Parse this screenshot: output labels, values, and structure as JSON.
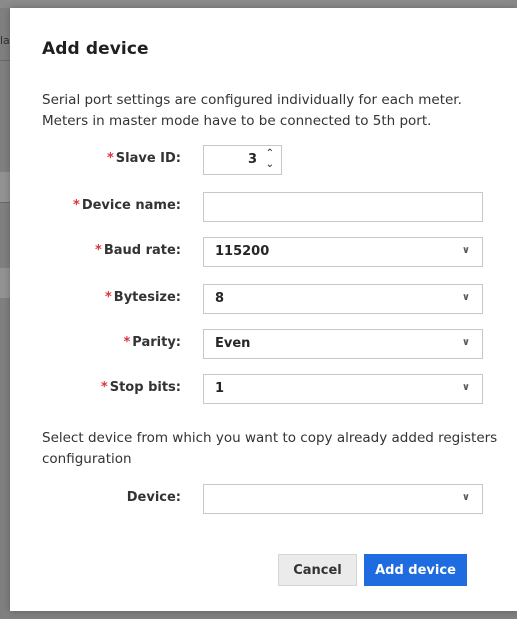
{
  "background": {
    "partial_text": "la"
  },
  "dialog": {
    "title": "Add device",
    "intro": "Serial port settings are configured individually for each meter. Meters in master mode have to be connected to 5th port.",
    "required_mark": "*",
    "fields": {
      "slave_id": {
        "label": "Slave ID:",
        "value": "3"
      },
      "device_name": {
        "label": "Device name:",
        "value": ""
      },
      "baud_rate": {
        "label": "Baud rate:",
        "value": "115200"
      },
      "bytesize": {
        "label": "Bytesize:",
        "value": "8"
      },
      "parity": {
        "label": "Parity:",
        "value": "Even"
      },
      "stop_bits": {
        "label": "Stop bits:",
        "value": "1"
      },
      "device": {
        "label": "Device:",
        "value": ""
      }
    },
    "copy_note": "Select device from which you want to copy already added registers configuration",
    "buttons": {
      "cancel": "Cancel",
      "add": "Add device"
    }
  },
  "colors": {
    "primary": "#1f6ce0",
    "required": "#e0323b"
  }
}
